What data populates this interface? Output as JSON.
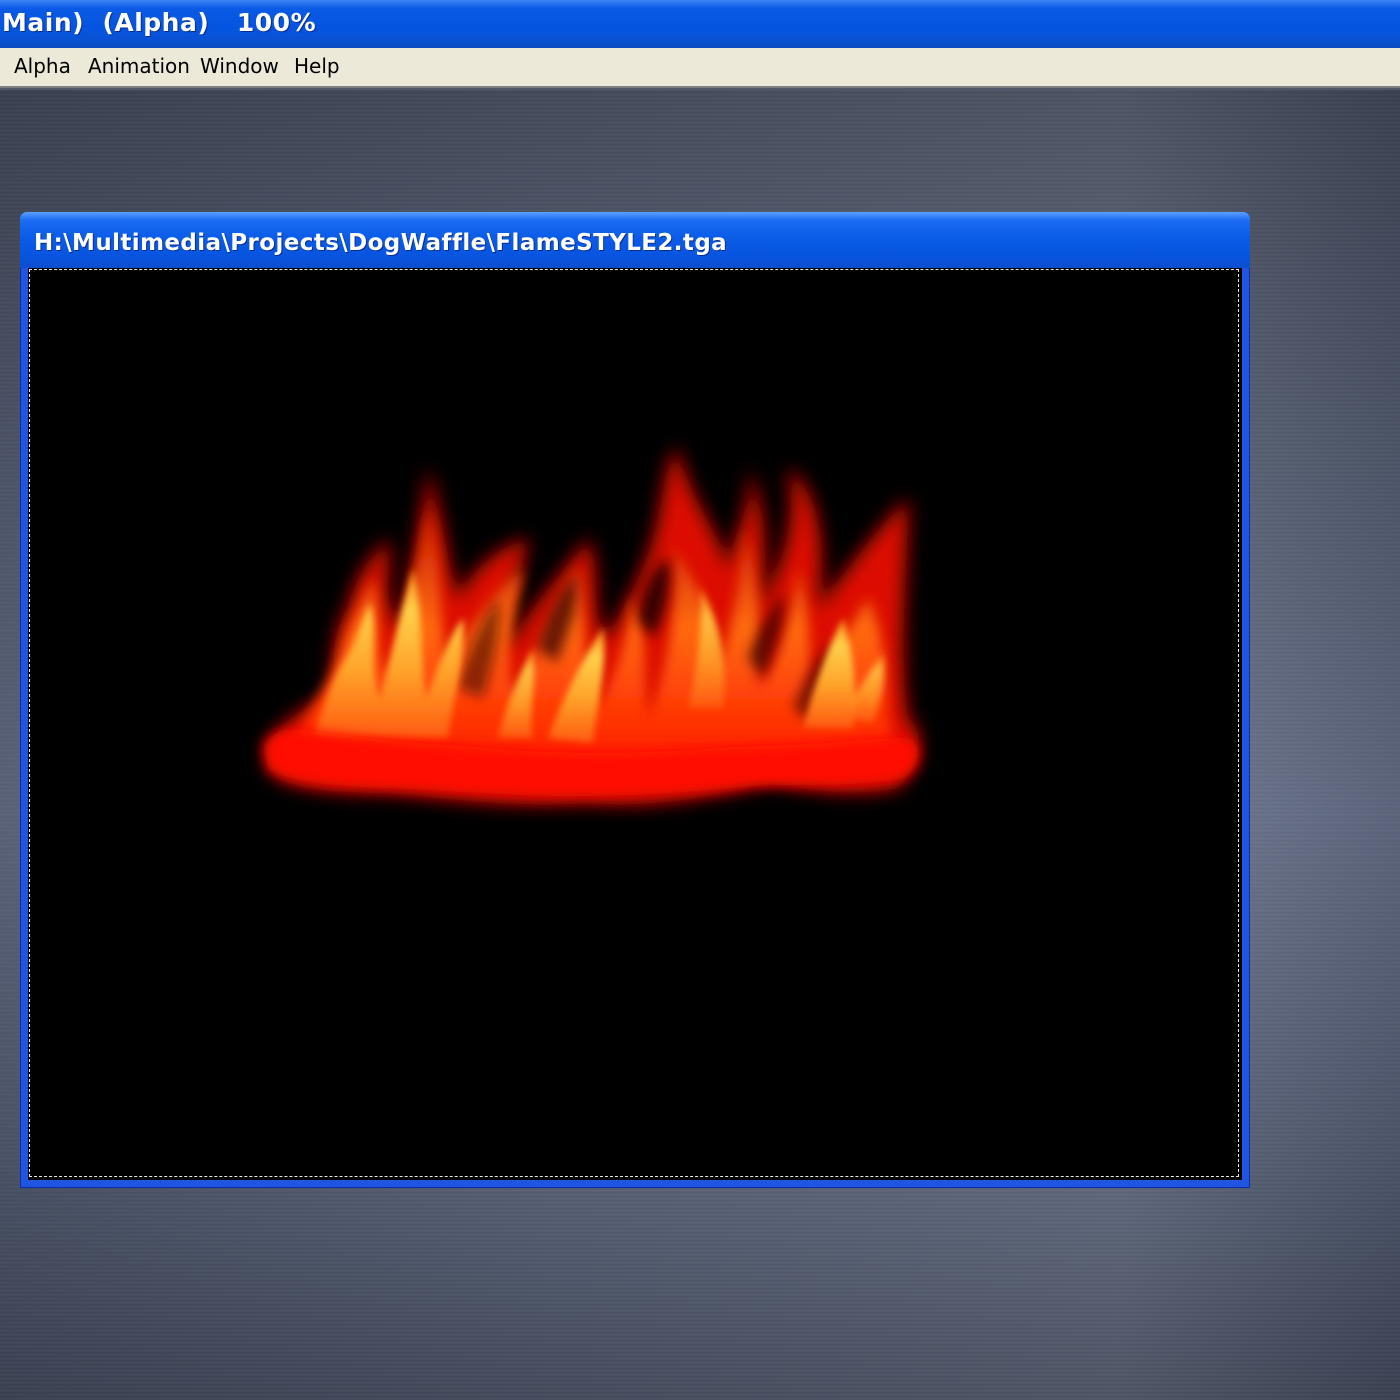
{
  "app": {
    "title": "Main)  (Alpha)   100%"
  },
  "menu": {
    "items": [
      {
        "label": "Alpha"
      },
      {
        "label": "Animation"
      },
      {
        "label": "Window"
      },
      {
        "label": "Help"
      }
    ]
  },
  "document": {
    "title": "H:\\Multimedia\\Projects\\DogWaffle\\FlameSTYLE2.tga",
    "canvas_background": "#000000"
  },
  "colors": {
    "titlebar_blue": "#0554e0",
    "menubar_bg": "#ece9d8",
    "flame_red": "#ff1a00",
    "flame_orange": "#ff7a10",
    "flame_yellow": "#ffc83a"
  }
}
